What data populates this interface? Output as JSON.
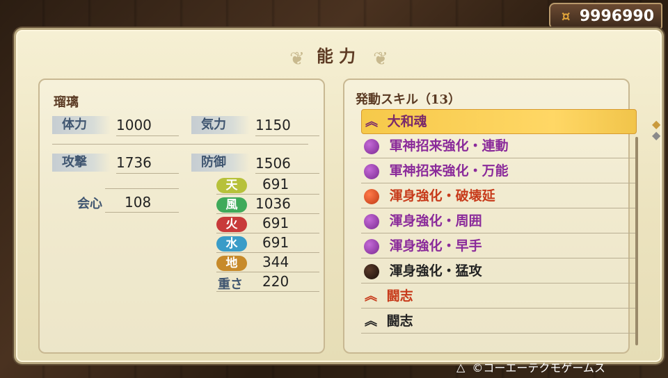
{
  "header": {
    "money": "9996990"
  },
  "panel": {
    "title": "能力"
  },
  "character": {
    "name": "瑠璃",
    "stats": [
      {
        "label": "体力",
        "value": "1000"
      },
      {
        "label": "気力",
        "value": "1150"
      },
      {
        "label": "攻撃",
        "value": "1736"
      },
      {
        "label": "防御",
        "value": "1506"
      },
      {
        "label": "会心",
        "value": "108"
      }
    ],
    "elements": [
      {
        "label": "天",
        "value": "691",
        "color": "#b7c13a"
      },
      {
        "label": "風",
        "value": "1036",
        "color": "#3faa5a"
      },
      {
        "label": "火",
        "value": "691",
        "color": "#c83a3a"
      },
      {
        "label": "水",
        "value": "691",
        "color": "#3a9cc8"
      },
      {
        "label": "地",
        "value": "344",
        "color": "#c78a2a"
      }
    ],
    "weight": {
      "label": "重さ",
      "value": "220"
    }
  },
  "skills": {
    "header": "発動スキル（13）",
    "items": [
      {
        "label": "大和魂",
        "color": "#7a2a6a",
        "icon": "chevron-up-icon"
      },
      {
        "label": "軍神招来強化・連動",
        "color": "#8a2a9a",
        "icon": "purple-orb-icon"
      },
      {
        "label": "軍神招来強化・万能",
        "color": "#8a2a9a",
        "icon": "purple-orb-icon"
      },
      {
        "label": "渾身強化・破壊延",
        "color": "#c73a1a",
        "icon": "red-orb-icon"
      },
      {
        "label": "渾身強化・周囲",
        "color": "#8a2a9a",
        "icon": "purple-orb-icon"
      },
      {
        "label": "渾身強化・早手",
        "color": "#8a2a9a",
        "icon": "purple-orb-icon"
      },
      {
        "label": "渾身強化・猛攻",
        "color": "#222222",
        "icon": "black-orb-icon"
      },
      {
        "label": "闘志",
        "color": "#c73a1a",
        "icon": "chevron-up-icon"
      },
      {
        "label": "闘志",
        "color": "#222222",
        "icon": "chevron-up-icon"
      }
    ]
  },
  "footer": {
    "text": "©コーエーテクモゲームス"
  }
}
